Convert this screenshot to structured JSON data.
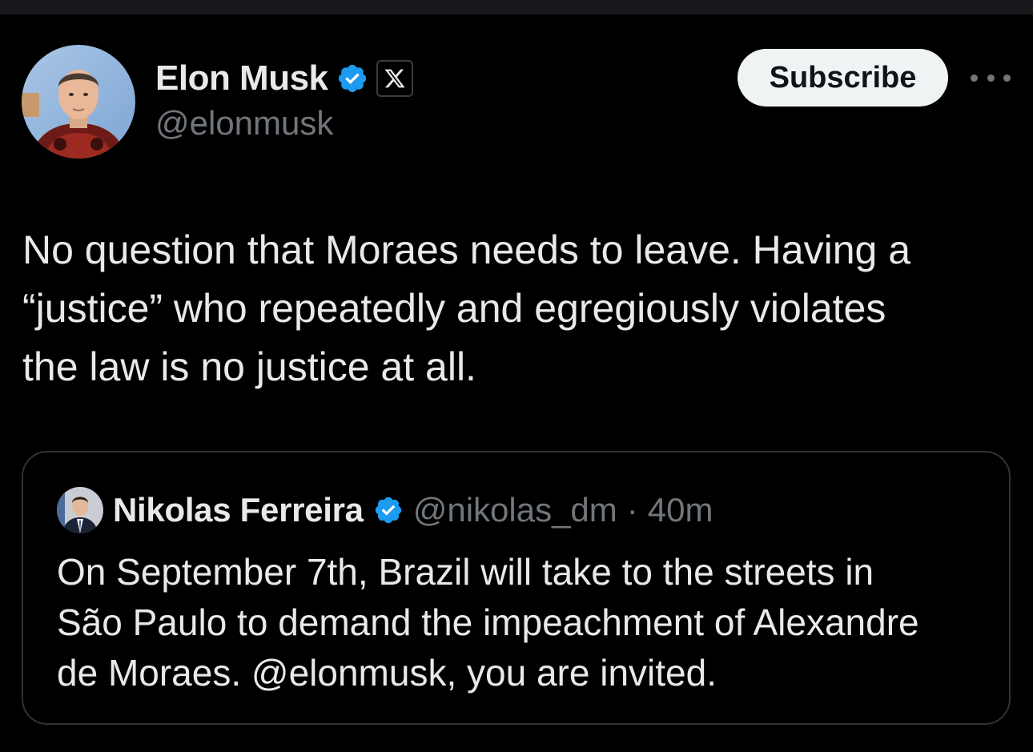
{
  "tweet": {
    "author": {
      "display_name": "Elon Musk",
      "handle": "@elonmusk",
      "verified_icon": "verified-badge-icon",
      "affiliation_icon": "x-logo-icon"
    },
    "subscribe_label": "Subscribe",
    "more_icon": "more-options-icon",
    "text": "No question that Moraes needs to leave. Having a\n“justice” who repeatedly and egregiously violates\nthe law is no justice at all."
  },
  "quote": {
    "author": {
      "display_name": "Nikolas Ferreira",
      "handle": "@nikolas_dm",
      "separator": "·",
      "time": "40m",
      "verified_icon": "verified-badge-icon"
    },
    "text": "On September 7th, Brazil will take to the streets in\nSão Paulo to demand the impeachment of Alexandre\nde Moraes. @elonmusk, you are invited."
  },
  "colors": {
    "background": "#000000",
    "text_primary": "#e7e9ea",
    "text_secondary": "#71767b",
    "verified_blue": "#1d9bf0",
    "button_bg": "#eff3f4",
    "border": "#2f3336"
  }
}
